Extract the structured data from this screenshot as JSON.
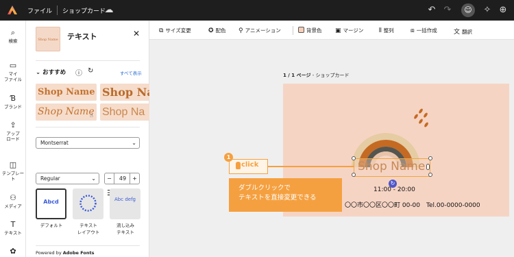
{
  "topbar": {
    "file_menu": "ファイル",
    "doc_title": "ショップカード"
  },
  "rail": {
    "items": [
      {
        "label": "検索",
        "icon": "search-icon"
      },
      {
        "label": "マイ\nファイル",
        "icon": "folder-icon"
      },
      {
        "label": "ブランド",
        "icon": "brand-icon"
      },
      {
        "label": "アップ\nロード",
        "icon": "upload-icon"
      },
      {
        "label": "テンプレート",
        "icon": "template-icon"
      },
      {
        "label": "メディア",
        "icon": "media-icon"
      },
      {
        "label": "テキスト",
        "icon": "text-icon"
      },
      {
        "label": "",
        "icon": "elements-icon"
      }
    ]
  },
  "panel": {
    "thumb_text": "Shop Name",
    "title": "テキスト",
    "recommended": "おすすめ",
    "show_all": "すべて表示",
    "samples": [
      "Shop Name",
      "Shop Na",
      "Shop Name",
      "Shop Na"
    ],
    "font_family": "Montserrat",
    "font_weight": "Regular",
    "font_size": "49",
    "stepper_minus": "−",
    "stepper_plus": "+",
    "layouts": [
      {
        "preview": "Abcd",
        "label": "デフォルト"
      },
      {
        "preview": "ABCDEFG",
        "label": "テキスト\nレイアウト"
      },
      {
        "preview": "Abc defg",
        "label": "流し込み\nテキスト"
      }
    ],
    "powered_prefix": "Powered by ",
    "powered_brand": "Adobe Fonts"
  },
  "contextbar": {
    "items": [
      "サイズ変更",
      "配色",
      "アニメーション",
      "背景色",
      "マージン",
      "整列",
      "一括作成",
      "翻訳"
    ]
  },
  "canvas": {
    "page_label_bold": "1 / 1 ページ",
    "page_label_rest": " - ショップカード",
    "selected_text": "Shop Name",
    "hours": "11:00 - 20:00",
    "address": "〇〇市〇〇区〇〇町 00-00　Tel.00-0000-0000"
  },
  "tutorial": {
    "step": "1",
    "click_label": "click",
    "callout_line1": "ダブルクリックで",
    "callout_line2": "テキストを直接変更できる"
  },
  "colors": {
    "accent_orange": "#f5a040",
    "card_bg": "#f6d4c4",
    "rotate_handle": "#4f56c8"
  }
}
